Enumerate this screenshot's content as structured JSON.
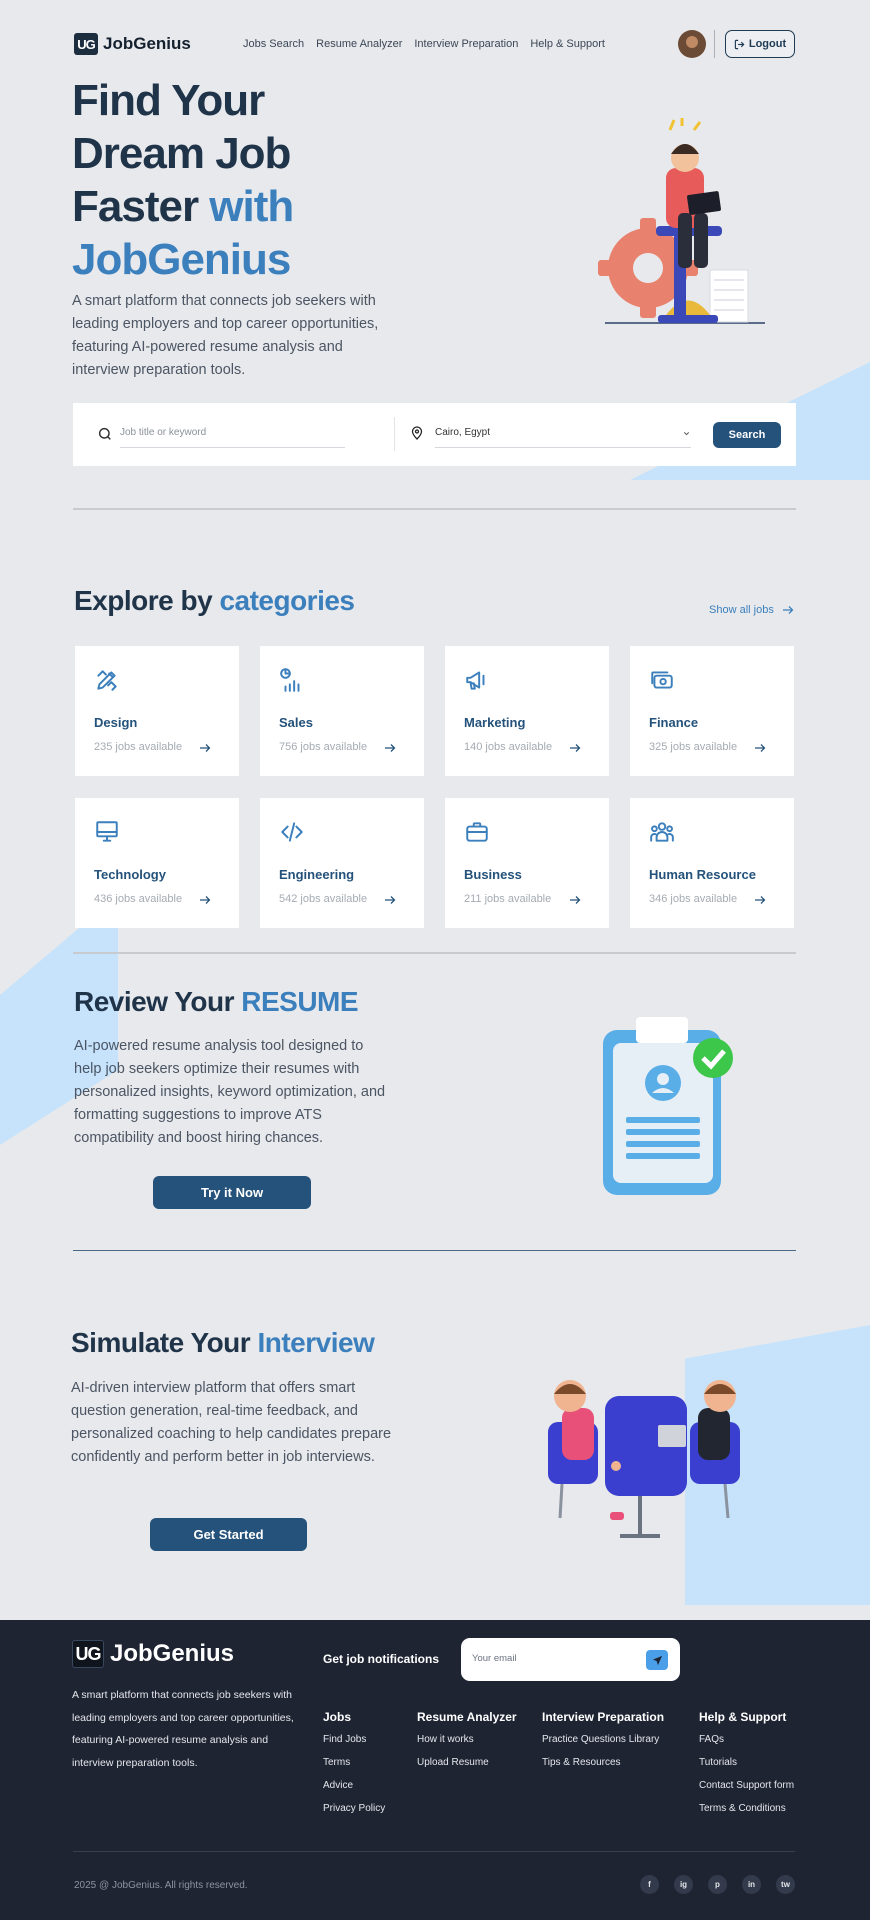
{
  "nav": {
    "logo_mark": "UG",
    "logo_text": "JobGenius",
    "menu": [
      "Jobs Search",
      "Resume Analyzer",
      "Interview Preparation",
      "Help & Support"
    ],
    "logout_label": "Logout"
  },
  "hero": {
    "title_line1": "Find Your",
    "title_line2": "Dream Job",
    "title_line3_a": "Faster ",
    "title_line3_b": "with",
    "title_line4": "JobGenius",
    "description": "A smart platform that connects job seekers with leading employers and top career opportunities, featuring AI-powered resume analysis and interview preparation tools."
  },
  "search": {
    "keyword_placeholder": "Job title or keyword",
    "location_value": "Cairo, Egypt",
    "button_label": "Search"
  },
  "categories": {
    "title_a": "Explore by ",
    "title_b": "categories",
    "show_all": "Show all jobs",
    "items": [
      {
        "name": "Design",
        "count": "235 jobs available",
        "icon": "pencil-ruler-icon"
      },
      {
        "name": "Sales",
        "count": "756 jobs available",
        "icon": "chart-icon"
      },
      {
        "name": "Marketing",
        "count": "140 jobs available",
        "icon": "megaphone-icon"
      },
      {
        "name": "Finance",
        "count": "325 jobs available",
        "icon": "money-icon"
      },
      {
        "name": "Technology",
        "count": "436 jobs available",
        "icon": "monitor-icon"
      },
      {
        "name": "Engineering",
        "count": "542 jobs available",
        "icon": "code-icon"
      },
      {
        "name": "Business",
        "count": "211 jobs available",
        "icon": "briefcase-icon"
      },
      {
        "name": "Human Resource",
        "count": "346 jobs available",
        "icon": "users-icon"
      }
    ]
  },
  "resume": {
    "title_a": "Review Your ",
    "title_b": "RESUME",
    "description": "AI-powered resume analysis tool designed to help job seekers optimize their resumes with personalized insights, keyword optimization, and formatting suggestions to improve ATS compatibility and boost hiring chances.",
    "button_label": "Try it Now"
  },
  "interview": {
    "title_a": "Simulate Your ",
    "title_b": "Interview",
    "description": "AI-driven interview platform that offers smart question generation, real-time feedback, and personalized coaching to help candidates prepare confidently and perform better in job interviews.",
    "button_label": "Get Started"
  },
  "footer": {
    "logo_mark": "UG",
    "logo_text": "JobGenius",
    "description": "A smart platform that connects job seekers with leading employers and top career opportunities, featuring AI-powered resume analysis and interview preparation tools.",
    "notifications_label": "Get job notifications",
    "email_placeholder": "Your email",
    "columns": [
      {
        "heading": "Jobs",
        "links": [
          "Find Jobs",
          "Terms",
          "Advice",
          "Privacy Policy"
        ]
      },
      {
        "heading": "Resume Analyzer",
        "links": [
          "How it works",
          "Upload Resume"
        ]
      },
      {
        "heading": "Interview Preparation",
        "links": [
          "Practice Questions Library",
          "Tips & Resources"
        ]
      },
      {
        "heading": "Help & Support",
        "links": [
          "FAQs",
          "Tutorials",
          "Contact Support form",
          "Terms & Conditions"
        ]
      }
    ],
    "copyright": "2025 @ JobGenius. All rights reserved.",
    "socials": [
      "f",
      "ig",
      "p",
      "in",
      "tw"
    ]
  },
  "colors": {
    "primary": "#24527a",
    "accent": "#3b7fbd",
    "dark": "#1f3349",
    "footer_bg": "#1f2433",
    "light_blue": "#c6e3fb"
  }
}
